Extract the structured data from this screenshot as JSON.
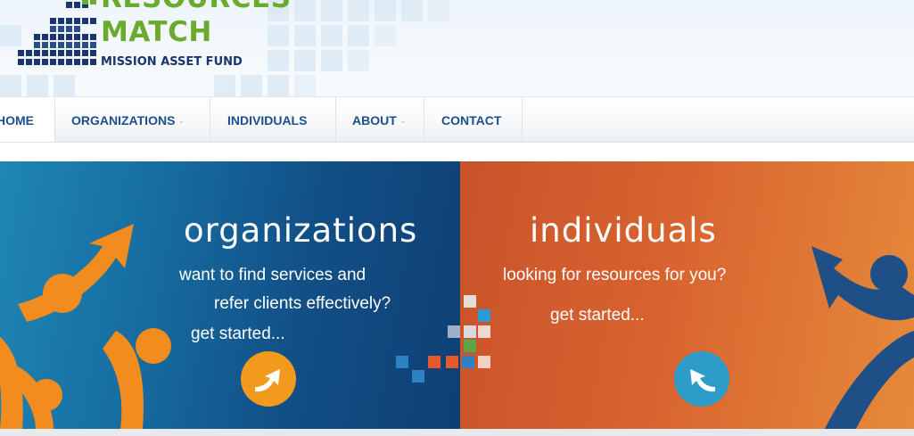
{
  "logo": {
    "line1": "RESOURCES",
    "line2": "MATCH",
    "line3": "MISSION ASSET FUND"
  },
  "nav": {
    "home": "HOME",
    "organizations": "ORGANIZATIONS",
    "individuals": "INDIVIDUALS",
    "about": "ABOUT",
    "contact": "CONTACT",
    "dropdown_glyph": "-"
  },
  "banner": {
    "organizations": {
      "title": "organizations",
      "line1": "want to find services and",
      "line2": "refer clients effectively?",
      "cta": "get started..."
    },
    "individuals": {
      "title": "individuals",
      "line1": "looking for resources for you?",
      "cta": "get started..."
    }
  },
  "colors": {
    "logo_green": "#6aab2e",
    "logo_navy": "#1a3571",
    "nav_text": "#1d4f8c",
    "org_blue": "#114f86",
    "indiv_orange": "#d8632f",
    "accent_orange": "#f29a1b",
    "accent_cyan": "#2d9cc8"
  },
  "icons": {
    "org_button": "arrow-up-right-icon",
    "indiv_button": "arrow-back-icon"
  }
}
